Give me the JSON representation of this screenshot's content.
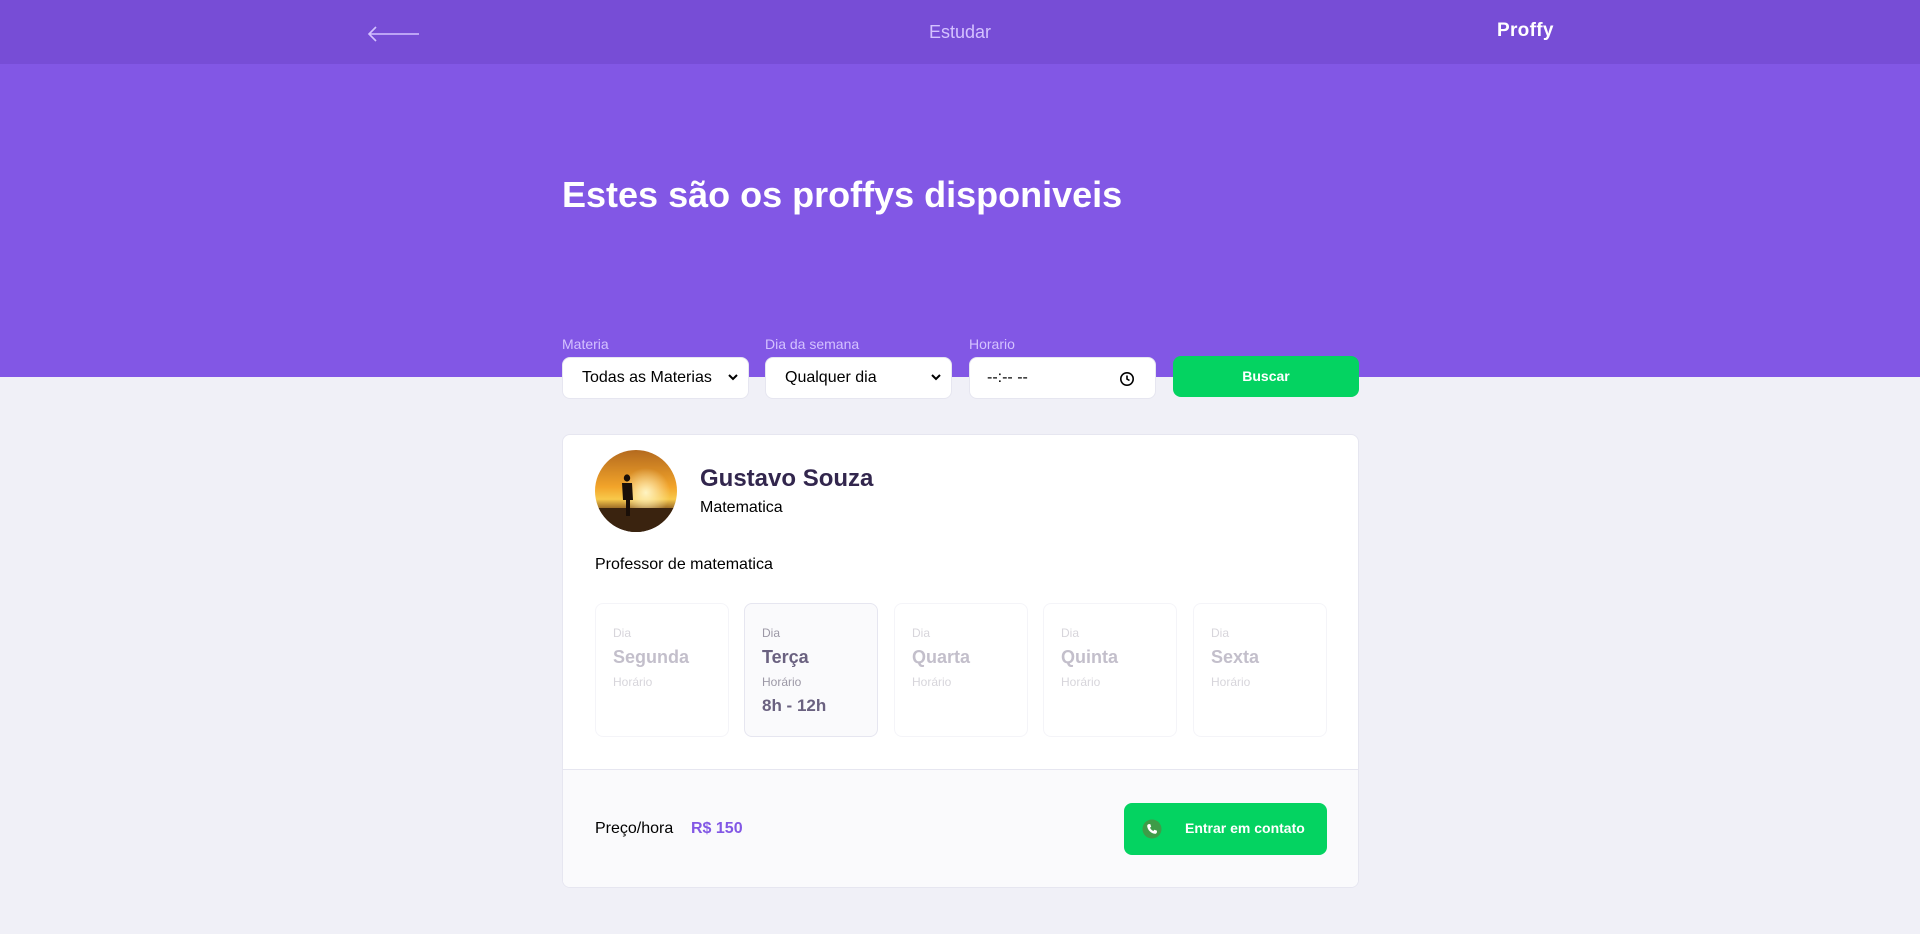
{
  "topbar": {
    "back_icon": "arrow-left-icon",
    "title": "Estudar",
    "logo": "Proffy"
  },
  "hero": {
    "title": "Estes são os proffys disponiveis"
  },
  "filters": {
    "subject": {
      "label": "Materia",
      "value": "Todas as Materias"
    },
    "weekday": {
      "label": "Dia da semana",
      "value": "Qualquer dia"
    },
    "time": {
      "label": "Horario",
      "value": "--:-- --"
    },
    "search_label": "Buscar"
  },
  "teacher": {
    "name": "Gustavo Souza",
    "subject": "Matematica",
    "bio": "Professor de matematica",
    "schedule": [
      {
        "day_label": "Dia",
        "day": "Segunda",
        "hour_label": "Horário",
        "hours": "",
        "active": false
      },
      {
        "day_label": "Dia",
        "day": "Terça",
        "hour_label": "Horário",
        "hours": "8h - 12h",
        "active": true
      },
      {
        "day_label": "Dia",
        "day": "Quarta",
        "hour_label": "Horário",
        "hours": "",
        "active": false
      },
      {
        "day_label": "Dia",
        "day": "Quinta",
        "hour_label": "Horário",
        "hours": "",
        "active": false
      },
      {
        "day_label": "Dia",
        "day": "Sexta",
        "hour_label": "Horário",
        "hours": "",
        "active": false
      }
    ],
    "price_label": "Preço/hora",
    "price": "R$ 150",
    "contact_label": "Entrar em contato",
    "contact_icon": "whatsapp-icon"
  },
  "colors": {
    "primary": "#8257E5",
    "primary_dark": "#774DD6",
    "secondary": "#04D361",
    "background": "#F0F0F7"
  }
}
